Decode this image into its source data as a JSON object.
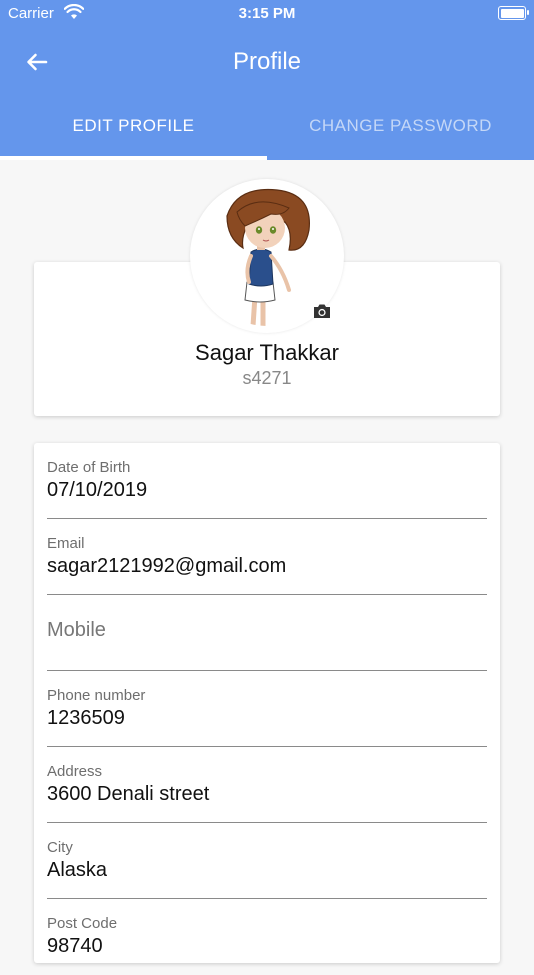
{
  "status": {
    "carrier": "Carrier",
    "time": "3:15 PM"
  },
  "header": {
    "title": "Profile"
  },
  "tabs": [
    {
      "label": "EDIT PROFILE",
      "active": true
    },
    {
      "label": "CHANGE PASSWORD",
      "active": false
    }
  ],
  "profile": {
    "name": "Sagar Thakkar",
    "username": "s4271"
  },
  "fields": [
    {
      "label": "Date of Birth",
      "value": "07/10/2019"
    },
    {
      "label": "Email",
      "value": "sagar2121992@gmail.com"
    },
    {
      "placeholder": "Mobile",
      "value": ""
    },
    {
      "label": "Phone number",
      "value": "1236509"
    },
    {
      "label": "Address",
      "value": "3600 Denali street"
    },
    {
      "label": "City",
      "value": "Alaska"
    },
    {
      "label": "Post Code",
      "value": "98740"
    }
  ],
  "colors": {
    "primary": "#6496ec",
    "background": "#f7f7f7"
  },
  "icons": {
    "back": "arrow-left-icon",
    "camera": "camera-icon",
    "wifi": "wifi-icon",
    "battery": "battery-icon"
  }
}
